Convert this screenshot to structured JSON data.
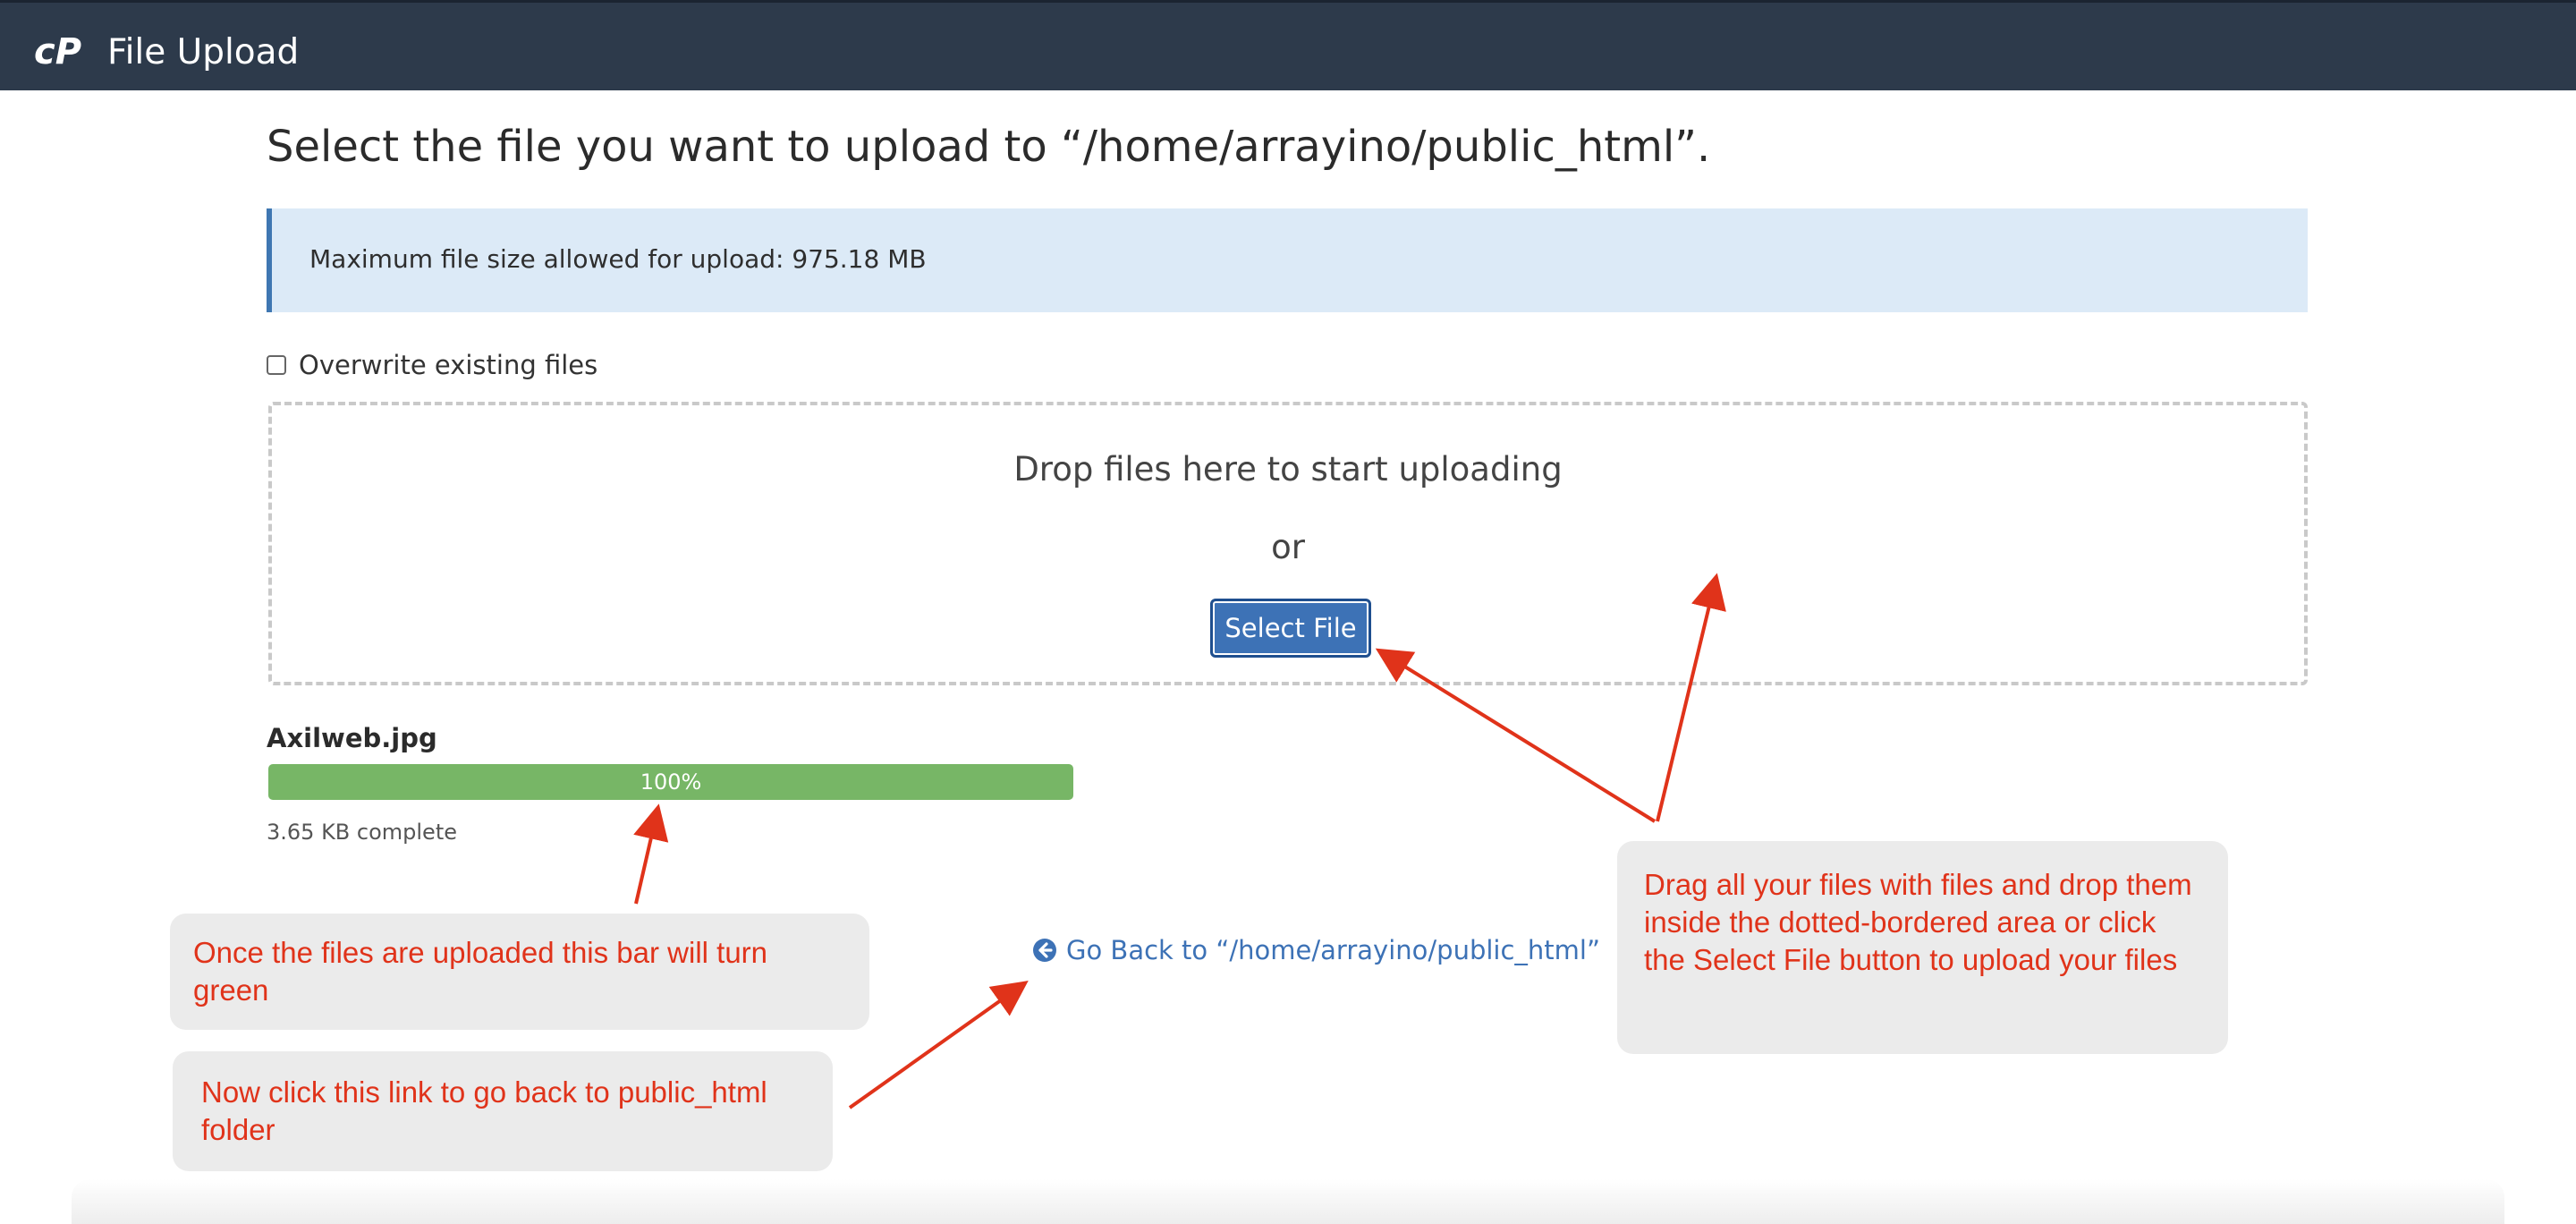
{
  "header": {
    "title": "File Upload",
    "logo_icon": "cpanel-logo-icon"
  },
  "main": {
    "heading": "Select the file you want to upload to “/home/arrayino/public_html”.",
    "info": "Maximum file size allowed for upload: 975.18 MB",
    "overwrite_label": "Overwrite existing files",
    "overwrite_checked": false,
    "dropzone": {
      "text": "Drop files here to start uploading",
      "or": "or",
      "select_button": "Select File"
    },
    "upload": {
      "file_name": "Axilweb.jpg",
      "progress_label": "100%",
      "progress_percent": 100,
      "status": "3.65 KB complete"
    },
    "back_link": {
      "label": "Go Back to “/home/arrayino/public_html”",
      "icon": "arrow-circle-left-icon"
    }
  },
  "annotations": {
    "callout_progress": "Once the files are uploaded this bar will turn green",
    "callout_link": "Now click this link to go back to public_html folder",
    "callout_drag": "Drag all your files with files and drop them inside the dotted-bordered area or click the Select File button to upload your files"
  },
  "colors": {
    "header_bg": "#2d3a4b",
    "info_bg": "#dceaf7",
    "info_border": "#3f77b2",
    "button_bg": "#3d72b6",
    "progress_fill": "#77b666",
    "link": "#3d72b6",
    "annotation_text": "#e0331a",
    "annotation_bg": "#ebebeb"
  }
}
